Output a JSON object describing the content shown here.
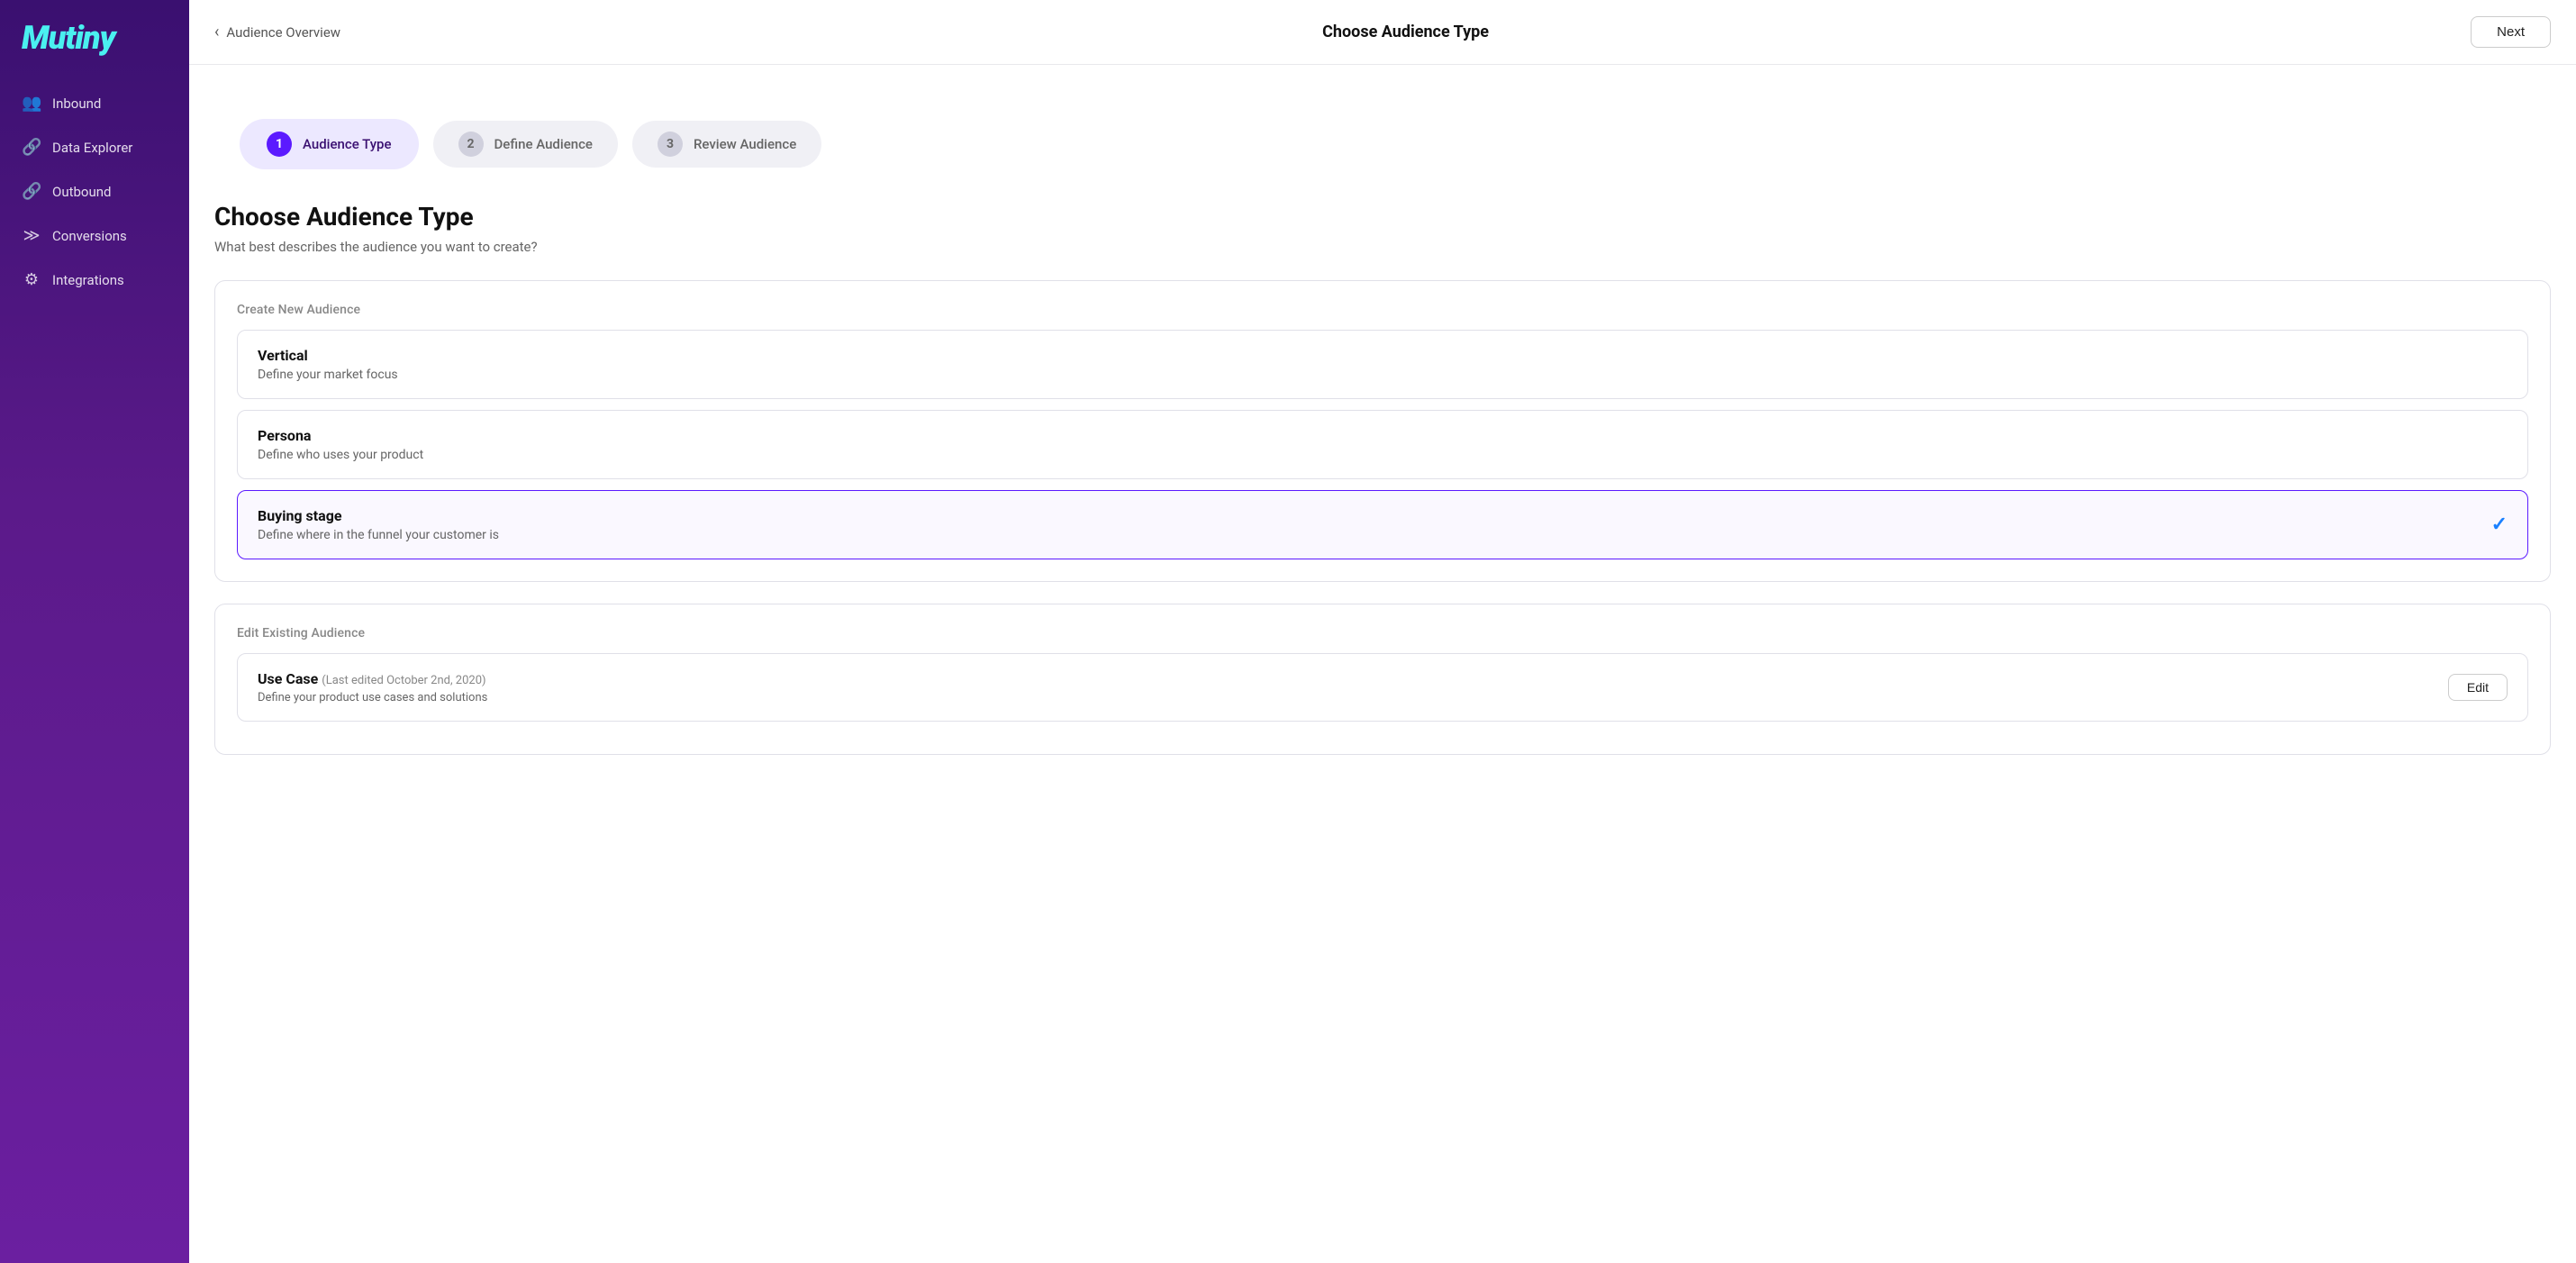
{
  "sidebar": {
    "logo": "Mutiny",
    "nav_items": [
      {
        "id": "inbound",
        "label": "Inbound",
        "icon": "👥"
      },
      {
        "id": "data-explorer",
        "label": "Data Explorer",
        "icon": "🔗"
      },
      {
        "id": "outbound",
        "label": "Outbound",
        "icon": "🔗"
      },
      {
        "id": "conversions",
        "label": "Conversions",
        "icon": "≫"
      },
      {
        "id": "integrations",
        "label": "Integrations",
        "icon": "⚙"
      }
    ]
  },
  "topbar": {
    "back_label": "Audience Overview",
    "title": "Choose Audience Type",
    "next_label": "Next"
  },
  "steps": [
    {
      "number": "1",
      "label": "Audience Type",
      "state": "active"
    },
    {
      "number": "2",
      "label": "Define Audience",
      "state": "inactive"
    },
    {
      "number": "3",
      "label": "Review Audience",
      "state": "inactive"
    }
  ],
  "page": {
    "heading": "Choose Audience Type",
    "subheading": "What best describes the audience you want to create?",
    "create_section_label": "Create New Audience",
    "edit_section_label": "Edit Existing Audience",
    "audience_types": [
      {
        "id": "vertical",
        "title": "Vertical",
        "desc": "Define your market focus",
        "selected": false
      },
      {
        "id": "persona",
        "title": "Persona",
        "desc": "Define who uses your product",
        "selected": false
      },
      {
        "id": "buying-stage",
        "title": "Buying stage",
        "desc": "Define where in the funnel your customer is",
        "selected": true
      }
    ],
    "existing_audiences": [
      {
        "id": "use-case",
        "title": "Use Case",
        "meta": "(Last edited October 2nd, 2020)",
        "desc": "Define your product use cases and solutions",
        "edit_label": "Edit"
      }
    ]
  }
}
